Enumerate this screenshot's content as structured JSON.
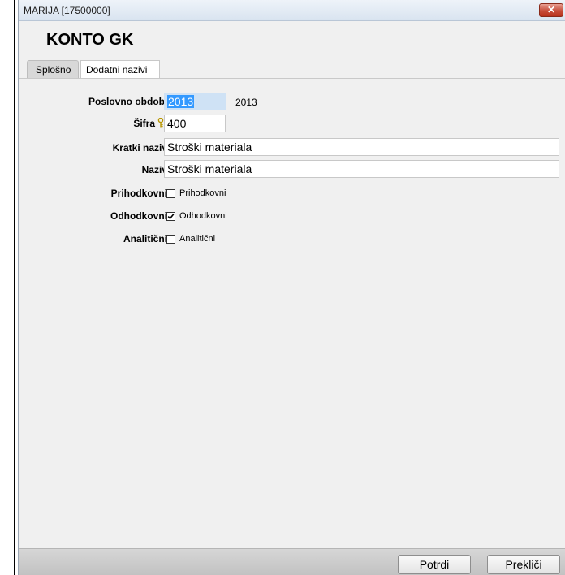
{
  "window": {
    "title": "MARIJA [17500000]",
    "close_glyph": "✕"
  },
  "form": {
    "title": "KONTO GK"
  },
  "tabs": [
    {
      "label": "Splošno",
      "active": true
    },
    {
      "label": "Dodatni nazivi",
      "active": false
    }
  ],
  "fields": {
    "poslovno_obdobje": {
      "label": "Poslovno obdobje",
      "value": "2013",
      "display": "2013",
      "icon": "key-icon"
    },
    "sifra": {
      "label": "Šifra",
      "value": "400",
      "icon": "key-icon"
    },
    "kratki_naziv": {
      "label": "Kratki naziv",
      "value": "Stroški materiala"
    },
    "naziv": {
      "label": "Naziv",
      "value": "Stroški materiala"
    },
    "prihodkovni": {
      "label": "Prihodkovni",
      "checkbox_label": "Prihodkovni",
      "checked": false
    },
    "odhodkovni": {
      "label": "Odhodkovni",
      "checkbox_label": "Odhodkovni",
      "checked": true
    },
    "analiticni": {
      "label": "Analitični",
      "checkbox_label": "Analitični",
      "checked": false
    }
  },
  "buttons": {
    "confirm": "Potrdi",
    "cancel": "Prekliči"
  },
  "colors": {
    "close_button": "#c74d3a",
    "selection": "#3399ff",
    "key_icon": "#d4b000"
  }
}
